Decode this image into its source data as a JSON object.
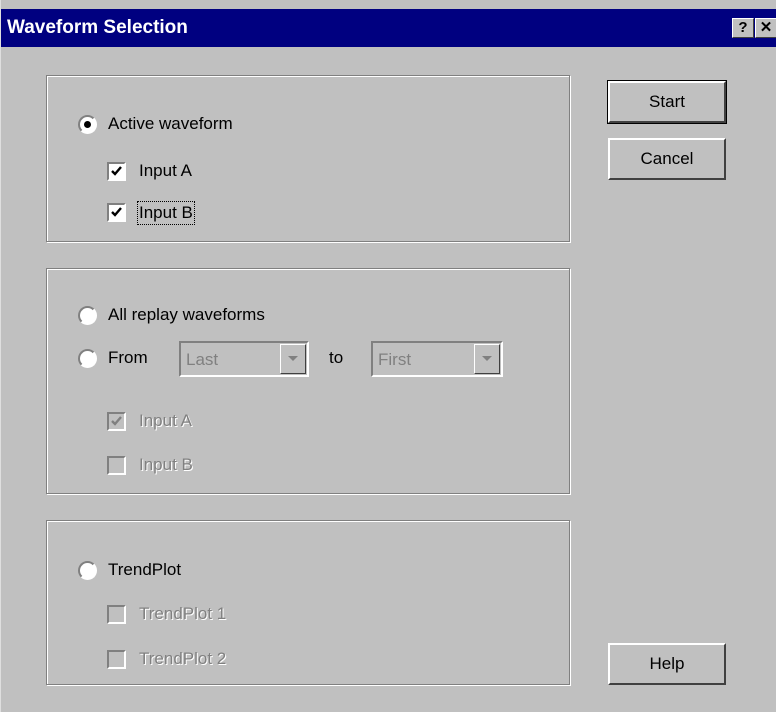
{
  "window": {
    "title": "Waveform Selection",
    "help_glyph": "?",
    "close_glyph": "✕"
  },
  "active_group": {
    "radio_label": "Active waveform",
    "radio_selected": true,
    "input_a": {
      "label": "Input A",
      "checked": true
    },
    "input_b": {
      "label": "Input B",
      "checked": true
    }
  },
  "replay_group": {
    "all_label": "All replay waveforms",
    "from_label": "From",
    "to_label": "to",
    "from_value": "Last",
    "to_value": "First",
    "input_a": {
      "label": "Input A",
      "checked": true,
      "disabled": true
    },
    "input_b": {
      "label": "Input B",
      "checked": false,
      "disabled": true
    }
  },
  "trend_group": {
    "radio_label": "TrendPlot",
    "plot1": {
      "label": "TrendPlot 1",
      "checked": false,
      "disabled": true
    },
    "plot2": {
      "label": "TrendPlot 2",
      "checked": false,
      "disabled": true
    }
  },
  "buttons": {
    "start": "Start",
    "cancel": "Cancel",
    "help": "Help"
  }
}
